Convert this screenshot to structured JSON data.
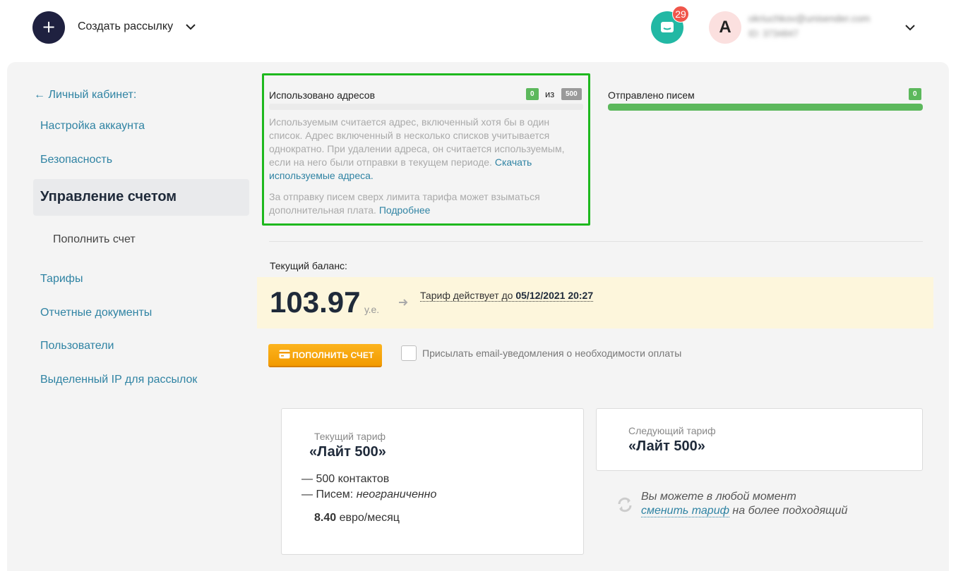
{
  "header": {
    "create_label": "Создать рассылку",
    "chat_badge": "29",
    "avatar_letter": "A",
    "user_email": "okriuchkov@unisender.com",
    "user_id": "ID: 3734847"
  },
  "sidebar": {
    "back_label": "← Личный кабинет:",
    "items": [
      {
        "label": "Настройка аккаунта"
      },
      {
        "label": "Безопасность"
      },
      {
        "label": "Управление счетом"
      },
      {
        "label": "Пополнить счет"
      },
      {
        "label": "Тарифы"
      },
      {
        "label": "Отчетные документы"
      },
      {
        "label": "Пользователи"
      },
      {
        "label": "Выделенный IP для рассылок"
      }
    ]
  },
  "addresses": {
    "title": "Использовано адресов",
    "used": "0",
    "of_label": "из",
    "limit": "500",
    "fill_fraction": 0,
    "note": "Используемым считается адрес, включенный хотя бы в один список. Адрес включенный в несколько списков учитывается однократно. При удалении адреса, он считается используемым, если на него были отправки в текущем периоде.",
    "note_link": "Скачать используемые адреса.",
    "note2": "За отправку писем сверх лимита тарифа может взыматься дополнительная плата.",
    "note2_link": "Подробнее"
  },
  "sent": {
    "title": "Отправлено писем",
    "count": "0",
    "fill_fraction": 1
  },
  "balance": {
    "label": "Текущий баланс:",
    "amount": "103.97",
    "unit": "у.е.",
    "tariff_until_prefix": "Тариф действует до",
    "tariff_until_date": "05/12/2021 20:27",
    "topup_label": "ПОПОЛНИТЬ СЧЕТ",
    "notify_label": "Присылать email-уведомления о необходимости оплаты"
  },
  "current_tariff": {
    "caption": "Текущий тариф",
    "name": "«Лайт 500»",
    "feature1": "— 500 контактов",
    "feature2_prefix": "— Писем:",
    "feature2_value": "неограниченно",
    "price_value": "8.40",
    "price_unit": "евро/месяц"
  },
  "next_tariff": {
    "caption": "Следующий тариф",
    "name": "«Лайт 500»"
  },
  "change_note": {
    "line1": "Вы можете в любой момент",
    "link": "сменить тариф",
    "line2_suffix": "на более подходящий"
  },
  "colors": {
    "accent": "#2f83a3",
    "success": "#5cb85c",
    "highlight_border": "#1eb81e",
    "button": "#f29a00"
  },
  "icons": [
    "plus-icon",
    "chevron-down-icon",
    "chat-icon",
    "arrow-right-icon",
    "card-icon",
    "refresh-icon"
  ]
}
